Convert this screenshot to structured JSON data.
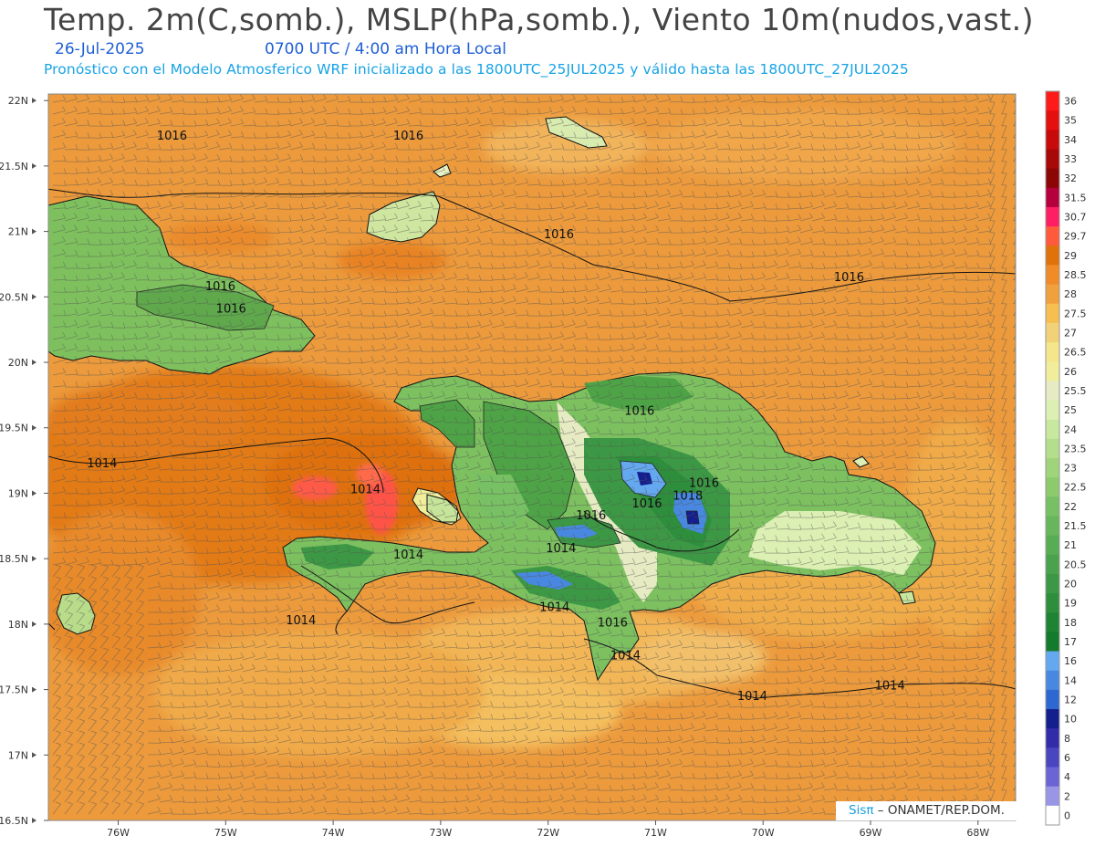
{
  "header": {
    "title": "Temp. 2m(C,somb.), MSLP(hPa,somb.), Viento 10m(nudos,vast.)",
    "date": "26-Jul-2025",
    "time": "0700 UTC / 4:00 am Hora Local",
    "description": "Pronóstico con el Modelo Atmosferico WRF inicializado a las 1800UTC_25JUL2025 y válido hasta las  1800UTC_27JUL2025"
  },
  "axes": {
    "lat_labels": [
      "22N",
      "21.5N",
      "21N",
      "20.5N",
      "20N",
      "19.5N",
      "19N",
      "18.5N",
      "18N",
      "17.5N",
      "17N",
      "16.5N"
    ],
    "lon_labels": [
      "76W",
      "75W",
      "74W",
      "73W",
      "72W",
      "71W",
      "70W",
      "69W",
      "68W"
    ],
    "lat_range": [
      16.5,
      22.05
    ],
    "lon_range": [
      -76.65,
      -67.65
    ]
  },
  "colorbar": {
    "labels": [
      "36",
      "35",
      "34",
      "33",
      "32",
      "31.5",
      "30.7",
      "29.7",
      "29",
      "28.5",
      "28",
      "27.5",
      "27",
      "26.5",
      "26",
      "25.5",
      "25",
      "24",
      "23.5",
      "23",
      "22.5",
      "22",
      "21.5",
      "21",
      "20.5",
      "20",
      "19",
      "18",
      "17",
      "16",
      "14",
      "12",
      "10",
      "8",
      "6",
      "4",
      "2",
      "0"
    ],
    "colors": [
      "#ff1a1a",
      "#e60f0f",
      "#c80a0a",
      "#a80808",
      "#8c0606",
      "#b4003c",
      "#ff1e64",
      "#ff5a3c",
      "#e0720a",
      "#f08b28",
      "#f0a03c",
      "#f7be50",
      "#f2d278",
      "#f5e68c",
      "#f0ee9a",
      "#e6ebc3",
      "#dcf0b4",
      "#c8e8a0",
      "#b4de8c",
      "#a0d47a",
      "#8cca6c",
      "#78c064",
      "#68b65c",
      "#58ac54",
      "#4aa24c",
      "#3c9844",
      "#2d8e3c",
      "#1e8434",
      "#147a2c",
      "#64a8f0",
      "#4888e0",
      "#2c68d0",
      "#141e8c",
      "#322ca8",
      "#4a46c0",
      "#6a64d4",
      "#9a96e6",
      "#ffffff"
    ]
  },
  "map_labels": {
    "isobars": [
      {
        "text": "1016",
        "lon": -75.5,
        "lat": 21.7
      },
      {
        "text": "1016",
        "lon": -73.3,
        "lat": 21.7
      },
      {
        "text": "1016",
        "lon": -71.9,
        "lat": 20.95
      },
      {
        "text": "1016",
        "lon": -69.2,
        "lat": 20.62
      },
      {
        "text": "1016",
        "lon": -75.05,
        "lat": 20.55
      },
      {
        "text": "1016",
        "lon": -74.95,
        "lat": 20.38
      },
      {
        "text": "1016",
        "lon": -71.15,
        "lat": 19.6
      },
      {
        "text": "1016",
        "lon": -70.55,
        "lat": 19.05
      },
      {
        "text": "1018",
        "lon": -70.7,
        "lat": 18.95
      },
      {
        "text": "1016",
        "lon": -71.08,
        "lat": 18.89
      },
      {
        "text": "1016",
        "lon": -71.6,
        "lat": 18.8
      },
      {
        "text": "1014",
        "lon": -76.15,
        "lat": 19.2
      },
      {
        "text": "1014",
        "lon": -73.7,
        "lat": 19.0
      },
      {
        "text": "1014",
        "lon": -73.3,
        "lat": 18.5
      },
      {
        "text": "1014",
        "lon": -71.88,
        "lat": 18.55
      },
      {
        "text": "1014",
        "lon": -71.94,
        "lat": 18.1
      },
      {
        "text": "1016",
        "lon": -71.4,
        "lat": 17.98
      },
      {
        "text": "1014",
        "lon": -71.28,
        "lat": 17.73
      },
      {
        "text": "1014",
        "lon": -74.3,
        "lat": 18.0
      },
      {
        "text": "1014",
        "lon": -70.1,
        "lat": 17.42
      },
      {
        "text": "1014",
        "lon": -68.82,
        "lat": 17.5
      }
    ]
  },
  "credit": {
    "brand": "Sisπ",
    "org": "– ONAMET/REP.DOM."
  }
}
